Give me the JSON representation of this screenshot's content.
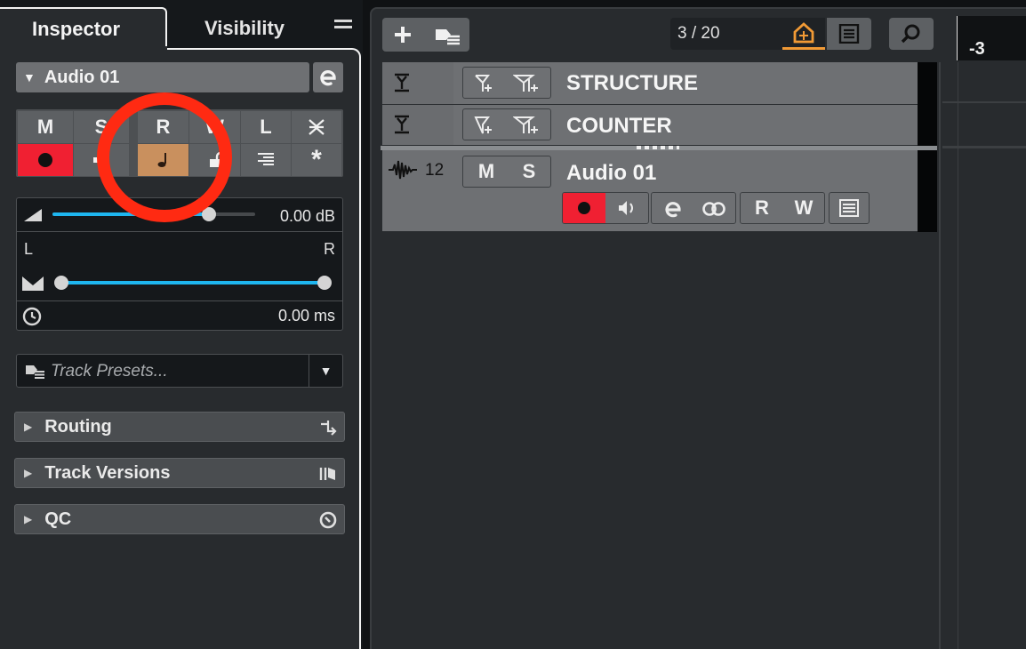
{
  "inspector": {
    "tabs": [
      {
        "label": "Inspector",
        "active": true
      },
      {
        "label": "Visibility",
        "active": false
      }
    ],
    "track_name": "Audio 01",
    "button_row1": [
      "M",
      "S",
      "R",
      "W",
      "L"
    ],
    "volume": "0.00 dB",
    "volume_fraction": 0.77,
    "pan_left": "L",
    "pan_right": "R",
    "delay": "0.00 ms",
    "presets_placeholder": "Track Presets...",
    "sections": [
      "Routing",
      "Track Versions",
      "QC"
    ]
  },
  "toolbar": {
    "counter": "3 / 20"
  },
  "ruler": {
    "label": "-3"
  },
  "tracks": [
    {
      "name": "STRUCTURE",
      "type": "marker"
    },
    {
      "name": "COUNTER",
      "type": "marker"
    },
    {
      "name": "Audio 01",
      "type": "audio",
      "number": "12",
      "mute": "M",
      "solo": "S",
      "read": "R",
      "write": "W"
    }
  ],
  "colors": {
    "record": "#f02032",
    "note_active": "#c9905e",
    "slider": "#1eb6f0",
    "annotation": "#ff2a12",
    "accent": "#f19a35"
  }
}
